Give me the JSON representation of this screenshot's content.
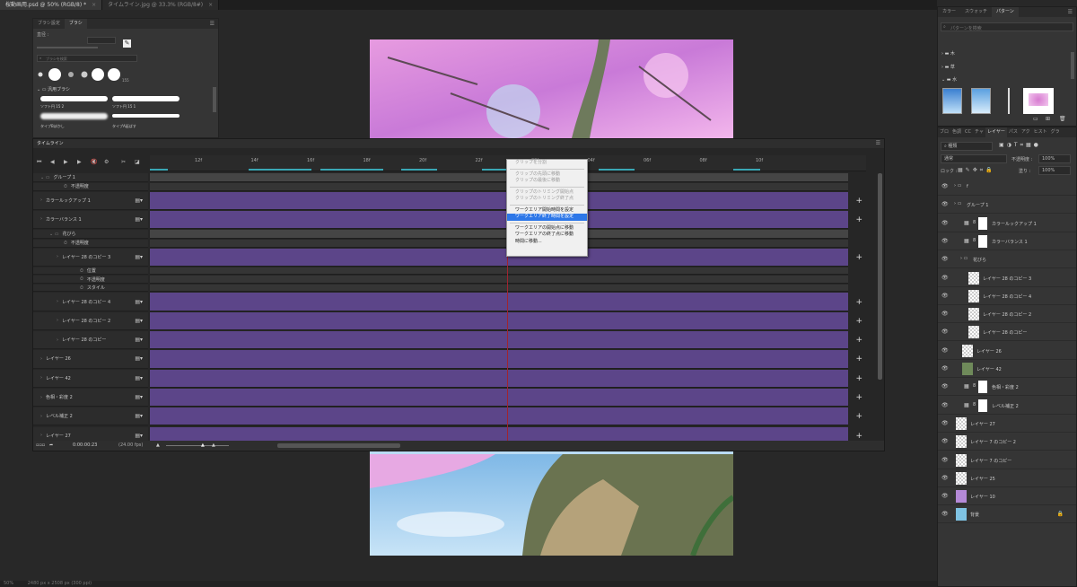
{
  "doc_tabs": [
    {
      "label": "桜動画用.psd @ 50% (RGB/8) *",
      "active": true
    },
    {
      "label": "タイムライン.jpg @ 33.3% (RGB/8#)",
      "active": false
    }
  ],
  "status_bar": {
    "zoom": "50%",
    "doc_info": "2480 px x 2508 px (300 ppi)"
  },
  "brush_panel": {
    "tabs": [
      "ブラシ設定",
      "ブラシ"
    ],
    "size_label": "直径 :",
    "search_placeholder": "ブラシを検索",
    "preset_count": "155",
    "folder": "汎用ブラシ",
    "brushes": [
      "ソフト円 15 2",
      "ソフト円 15 1",
      "タイプBぼかし",
      "タイプA延ばす"
    ]
  },
  "timeline": {
    "title": "タイムライン",
    "ruler_ticks": [
      "12f",
      "14f",
      "16f",
      "18f",
      "20f",
      "22f",
      "02f",
      "04f",
      "06f",
      "08f",
      "10f"
    ],
    "rows": [
      {
        "label": "グループ 1",
        "kind": "group"
      },
      {
        "label": "不透明度",
        "kind": "prop"
      },
      {
        "label": "カラールックアップ 1",
        "kind": "layer"
      },
      {
        "label": "カラーバランス 1",
        "kind": "layer"
      },
      {
        "label": "花びら",
        "kind": "group"
      },
      {
        "label": "不透明度",
        "kind": "prop"
      },
      {
        "label": "レイヤー 28 のコピー 3",
        "kind": "layer"
      },
      {
        "label": "位置",
        "kind": "prop"
      },
      {
        "label": "不透明度",
        "kind": "prop"
      },
      {
        "label": "スタイル",
        "kind": "prop"
      },
      {
        "label": "レイヤー 28 のコピー 4",
        "kind": "layer"
      },
      {
        "label": "レイヤー 28 のコピー 2",
        "kind": "layer"
      },
      {
        "label": "レイヤー 28 のコピー",
        "kind": "layer"
      },
      {
        "label": "レイヤー 26",
        "kind": "layer"
      },
      {
        "label": "レイヤー 42",
        "kind": "layer"
      },
      {
        "label": "色相・彩度 2",
        "kind": "layer"
      },
      {
        "label": "レベル補正 2",
        "kind": "layer"
      },
      {
        "label": "レイヤー 27",
        "kind": "layer"
      }
    ],
    "timecode": "0:00:00:23",
    "fps": "(24.00 fps)"
  },
  "context_menu": {
    "items": [
      {
        "label": "クリップを分割",
        "disabled": true
      },
      {
        "sep": true
      },
      {
        "label": "クリップの先頭に移動",
        "disabled": true
      },
      {
        "label": "クリップの最後に移動",
        "disabled": true
      },
      {
        "sep": true
      },
      {
        "label": "クリップのトリミング開始点",
        "disabled": true
      },
      {
        "label": "クリップのトリミング終了点",
        "disabled": true
      },
      {
        "sep": true
      },
      {
        "label": "ワークエリア開始時間を設定",
        "disabled": false
      },
      {
        "label": "ワークエリア終了時間を設定",
        "disabled": false,
        "selected": true
      },
      {
        "sep": true
      },
      {
        "label": "ワークエリアの開始点に移動",
        "disabled": false
      },
      {
        "label": "ワークエリアの終了点に移動",
        "disabled": false
      },
      {
        "label": "時間に移動...",
        "disabled": false
      }
    ]
  },
  "swatch_panel": {
    "tabs": [
      "カラー",
      "スウォッチ",
      "パターン"
    ],
    "search_placeholder": "パターンを検索",
    "folders": [
      "木",
      "草",
      "水"
    ]
  },
  "layers_panel": {
    "tabs": [
      "ブロ",
      "色調",
      "CC",
      "チャ",
      "レイヤー",
      "パス",
      "アク",
      "ヒスト",
      "グラ"
    ],
    "kind_label": "種類",
    "blend_mode": "通常",
    "opacity_label": "不透明度 :",
    "opacity_value": "100%",
    "lock_label": "ロック :",
    "fill_label": "塗り :",
    "fill_value": "100%",
    "layers": [
      {
        "name": "f",
        "indent": 0,
        "type": "group"
      },
      {
        "name": "グループ 1",
        "indent": 0,
        "type": "group"
      },
      {
        "name": "カラールックアップ 1",
        "indent": 1,
        "type": "adj"
      },
      {
        "name": "カラーバランス 1",
        "indent": 1,
        "type": "adj"
      },
      {
        "name": "花びら",
        "indent": 1,
        "type": "group"
      },
      {
        "name": "レイヤー 28 のコピー 3",
        "indent": 2,
        "type": "layer"
      },
      {
        "name": "レイヤー 28 のコピー 4",
        "indent": 2,
        "type": "layer"
      },
      {
        "name": "レイヤー 28 のコピー 2",
        "indent": 2,
        "type": "layer"
      },
      {
        "name": "レイヤー 28 のコピー",
        "indent": 2,
        "type": "layer"
      },
      {
        "name": "レイヤー 26",
        "indent": 1,
        "type": "layer"
      },
      {
        "name": "レイヤー 42",
        "indent": 1,
        "type": "layer"
      },
      {
        "name": "色相・彩度 2",
        "indent": 1,
        "type": "adj"
      },
      {
        "name": "レベル補正 2",
        "indent": 1,
        "type": "adj"
      },
      {
        "name": "レイヤー 27",
        "indent": 0,
        "type": "layer"
      },
      {
        "name": "レイヤー 7 のコピー 2",
        "indent": 0,
        "type": "layer"
      },
      {
        "name": "レイヤー 7 のコピー",
        "indent": 0,
        "type": "layer"
      },
      {
        "name": "レイヤー 25",
        "indent": 0,
        "type": "layer"
      },
      {
        "name": "レイヤー 10",
        "indent": 0,
        "type": "layer"
      },
      {
        "name": "背景",
        "indent": 0,
        "type": "bg"
      }
    ]
  }
}
